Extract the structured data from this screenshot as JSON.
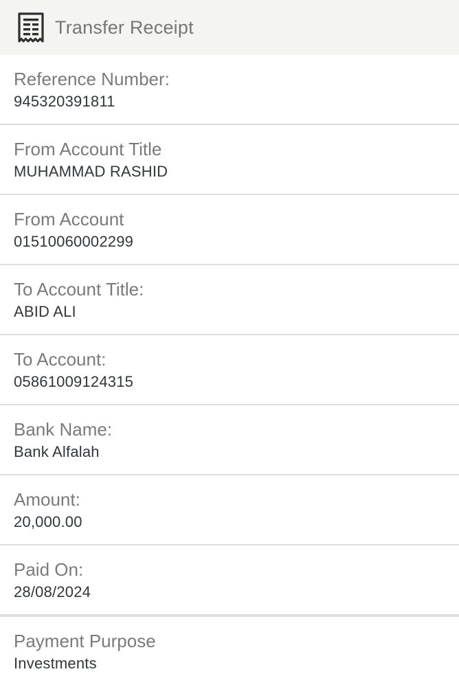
{
  "header": {
    "icon": "receipt-icon",
    "title": "Transfer Receipt"
  },
  "fields": [
    {
      "label": "Reference Number:",
      "value": "945320391811"
    },
    {
      "label": "From Account Title",
      "value": "MUHAMMAD RASHID"
    },
    {
      "label": "From Account",
      "value": "01510060002299"
    },
    {
      "label": "To Account Title:",
      "value": "ABID ALI"
    },
    {
      "label": "To Account:",
      "value": "05861009124315"
    },
    {
      "label": "Bank Name:",
      "value": "Bank Alfalah"
    },
    {
      "label": "Amount:",
      "value": "20,000.00"
    },
    {
      "label": "Paid On:",
      "value": "28/08/2024"
    },
    {
      "label": "Payment Purpose",
      "value": "Investments"
    }
  ]
}
